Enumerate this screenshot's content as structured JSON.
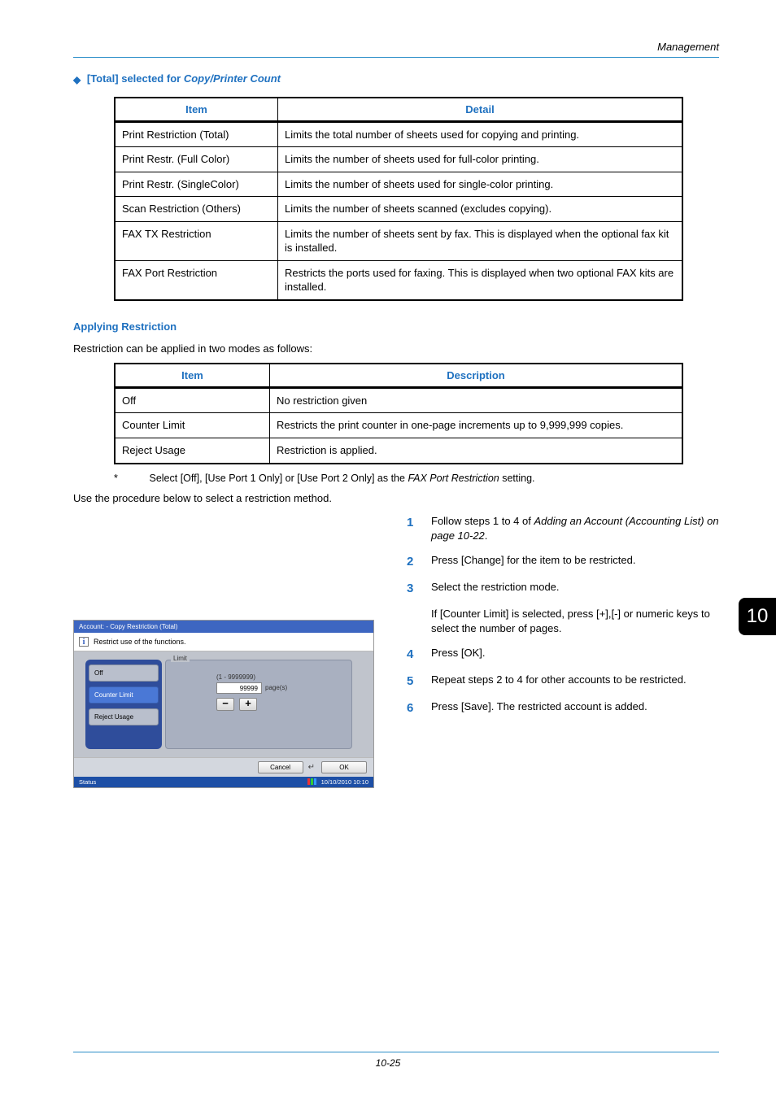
{
  "header": {
    "running": "Management"
  },
  "sideBadge": "10",
  "pageNum": "10-25",
  "sec1": {
    "title": "[Total] selected for Copy/Printer Count",
    "col1": "Item",
    "col2": "Detail",
    "rows": [
      {
        "item": "Print Restriction (Total)",
        "detail": "Limits the total number of sheets used for copying and printing."
      },
      {
        "item": "Print Restr. (Full Color)",
        "detail": "Limits the number of sheets used for full-color printing."
      },
      {
        "item": "Print Restr. (SingleColor)",
        "detail": "Limits the number of sheets used for single-color printing."
      },
      {
        "item": "Scan Restriction (Others)",
        "detail": "Limits the number of sheets scanned (excludes copying)."
      },
      {
        "item": "FAX TX Restriction",
        "detail": "Limits the number of sheets sent by fax. This is displayed when the optional fax kit is installed."
      },
      {
        "item": "FAX Port Restriction",
        "detail": "Restricts the ports used for faxing. This is displayed when two optional FAX kits are installed."
      }
    ]
  },
  "sec2": {
    "title": "Applying Restriction",
    "intro": "Restriction can be applied in two modes as follows:",
    "col1": "Item",
    "col2": "Description",
    "rows": [
      {
        "item": "Off",
        "desc": "No restriction given"
      },
      {
        "item": "Counter Limit",
        "desc": "Restricts the print counter in one-page increments up to 9,999,999 copies."
      },
      {
        "item": "Reject Usage",
        "desc": "Restriction is applied."
      }
    ],
    "footnote_star": "*",
    "footnote_a": "Select [Off], [Use Port 1 Only] or [Use Port 2 Only] as the ",
    "footnote_b": "FAX Port Restriction",
    "footnote_c": " setting.",
    "lead": "Use the procedure below to select a restriction method."
  },
  "steps": {
    "s1_a": "Follow steps 1 to 4 of ",
    "s1_b": "Adding an Account (Accounting List) on page 10-22",
    "s1_c": ".",
    "s2": "Press [Change] for the item to be restricted.",
    "s3": "Select the restriction mode.",
    "s3_note": "If [Counter Limit] is selected, press [+],[-] or numeric keys to select the number of pages.",
    "s4": "Press [OK].",
    "s5": "Repeat steps 2 to 4 for other accounts to be restricted.",
    "s6": "Press [Save]. The restricted account is added.",
    "n1": "1",
    "n2": "2",
    "n3": "3",
    "n4": "4",
    "n5": "5",
    "n6": "6"
  },
  "dialog": {
    "title": "Account: - Copy Restriction (Total)",
    "info": "Restrict use of the functions.",
    "btn_off": "Off",
    "btn_counter": "Counter Limit",
    "btn_reject": "Reject Usage",
    "limit_label": "Limit",
    "range": "(1 - 9999999)",
    "value": "99999",
    "unit": "page(s)",
    "minus": "−",
    "plus": "+",
    "cancel": "Cancel",
    "ok": "OK",
    "enter": "↵",
    "status": "Status",
    "datetime": "10/10/2010  10:10"
  }
}
